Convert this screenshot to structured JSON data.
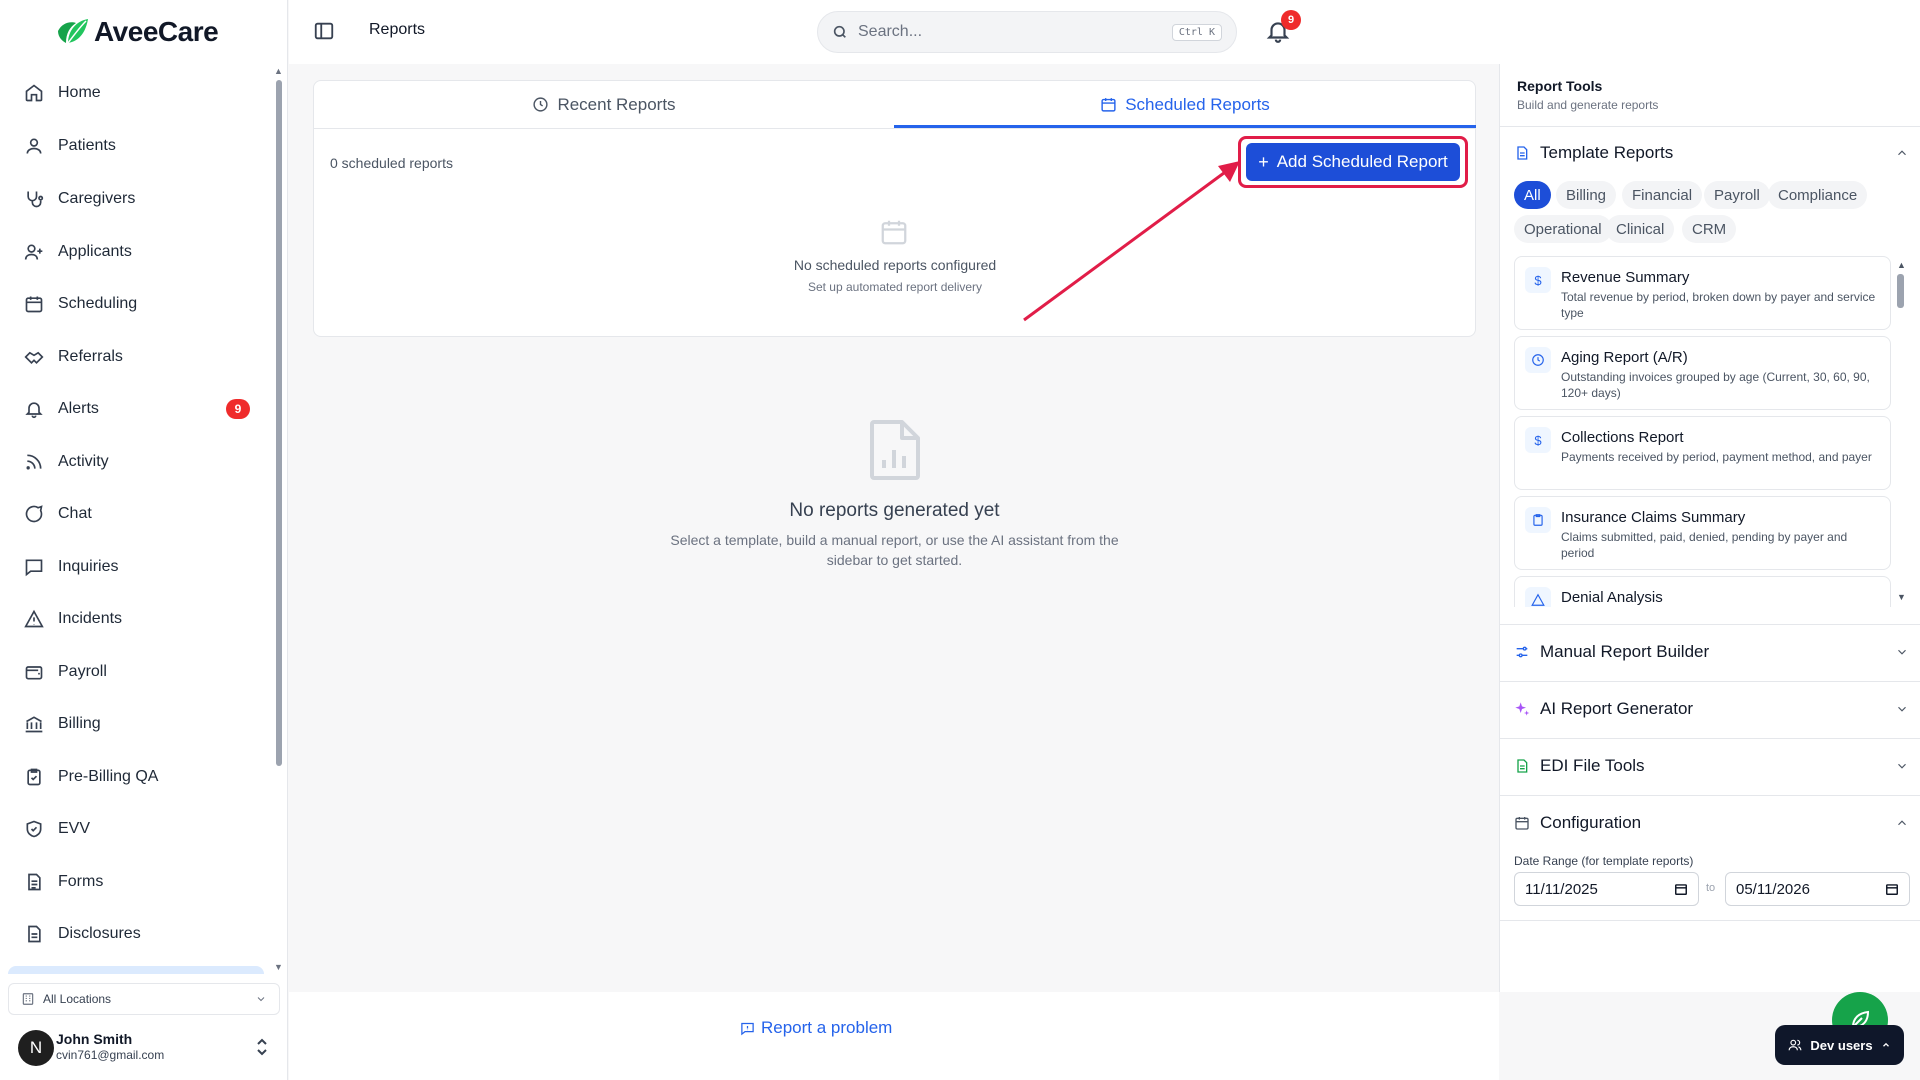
{
  "brand": {
    "name": "AveeCare",
    "color": "#16a34a"
  },
  "sidebar": {
    "items": [
      {
        "label": "Home",
        "icon": "home-icon"
      },
      {
        "label": "Patients",
        "icon": "user-icon"
      },
      {
        "label": "Caregivers",
        "icon": "stethoscope-icon"
      },
      {
        "label": "Applicants",
        "icon": "user-plus-icon"
      },
      {
        "label": "Scheduling",
        "icon": "calendar-icon"
      },
      {
        "label": "Referrals",
        "icon": "handshake-icon"
      },
      {
        "label": "Alerts",
        "icon": "bell-icon",
        "badge": "9"
      },
      {
        "label": "Activity",
        "icon": "rss-icon"
      },
      {
        "label": "Chat",
        "icon": "chat-bubble-icon"
      },
      {
        "label": "Inquiries",
        "icon": "message-square-icon"
      },
      {
        "label": "Incidents",
        "icon": "warning-triangle-icon"
      },
      {
        "label": "Payroll",
        "icon": "wallet-icon"
      },
      {
        "label": "Billing",
        "icon": "bank-icon"
      },
      {
        "label": "Pre-Billing QA",
        "icon": "clipboard-check-icon"
      },
      {
        "label": "EVV",
        "icon": "shield-check-icon"
      },
      {
        "label": "Forms",
        "icon": "file-text-icon"
      },
      {
        "label": "Disclosures",
        "icon": "document-icon"
      }
    ],
    "location": "All Locations",
    "user": {
      "initial": "N",
      "name": "John Smith",
      "email": "cvin761@gmail.com"
    }
  },
  "header": {
    "title": "Reports",
    "search_placeholder": "Search...",
    "search_shortcut": "Ctrl K",
    "notification_count": "9"
  },
  "main": {
    "tabs": [
      {
        "label": "Recent Reports",
        "icon": "clock-icon",
        "active": false
      },
      {
        "label": "Scheduled Reports",
        "icon": "calendar-icon",
        "active": true
      }
    ],
    "scheduled_count": "0 scheduled reports",
    "add_button": "Add Scheduled Report",
    "empty_scheduled": {
      "title": "No scheduled reports configured",
      "subtitle": "Set up automated report delivery"
    },
    "empty_reports": {
      "title": "No reports generated yet",
      "subtitle": "Select a template, build a manual report, or use the AI assistant from the sidebar to get started."
    },
    "report_problem": "Report a problem",
    "accent_color": "#2563eb",
    "highlight_color": "#e11d48"
  },
  "right_panel": {
    "title": "Report Tools",
    "subtitle": "Build and generate reports",
    "template_section": "Template Reports",
    "filters": [
      "All",
      "Billing",
      "Financial",
      "Payroll",
      "Compliance",
      "Operational",
      "Clinical",
      "CRM"
    ],
    "active_filter": "All",
    "templates": [
      {
        "name": "Revenue Summary",
        "desc": "Total revenue by period, broken down by payer and service type",
        "icon": "dollar-icon"
      },
      {
        "name": "Aging Report (A/R)",
        "desc": "Outstanding invoices grouped by age (Current, 30, 60, 90, 120+ days)",
        "icon": "clock-icon"
      },
      {
        "name": "Collections Report",
        "desc": "Payments received by period, payment method, and payer",
        "icon": "dollar-icon"
      },
      {
        "name": "Insurance Claims Summary",
        "desc": "Claims submitted, paid, denied, pending by payer and period",
        "icon": "clipboard-icon"
      },
      {
        "name": "Denial Analysis",
        "desc": "",
        "icon": "warning-triangle-icon"
      }
    ],
    "sections": [
      {
        "label": "Manual Report Builder",
        "icon": "sliders-icon",
        "expanded": false
      },
      {
        "label": "AI Report Generator",
        "icon": "sparkles-icon",
        "expanded": false
      },
      {
        "label": "EDI File Tools",
        "icon": "file-icon",
        "expanded": false
      },
      {
        "label": "Configuration",
        "icon": "calendar-icon",
        "expanded": true
      }
    ],
    "config": {
      "date_range_label": "Date Range (for template reports)",
      "from": "11/11/2025",
      "to_label": "to",
      "to": "05/11/2026"
    }
  },
  "dev_users": "Dev users"
}
